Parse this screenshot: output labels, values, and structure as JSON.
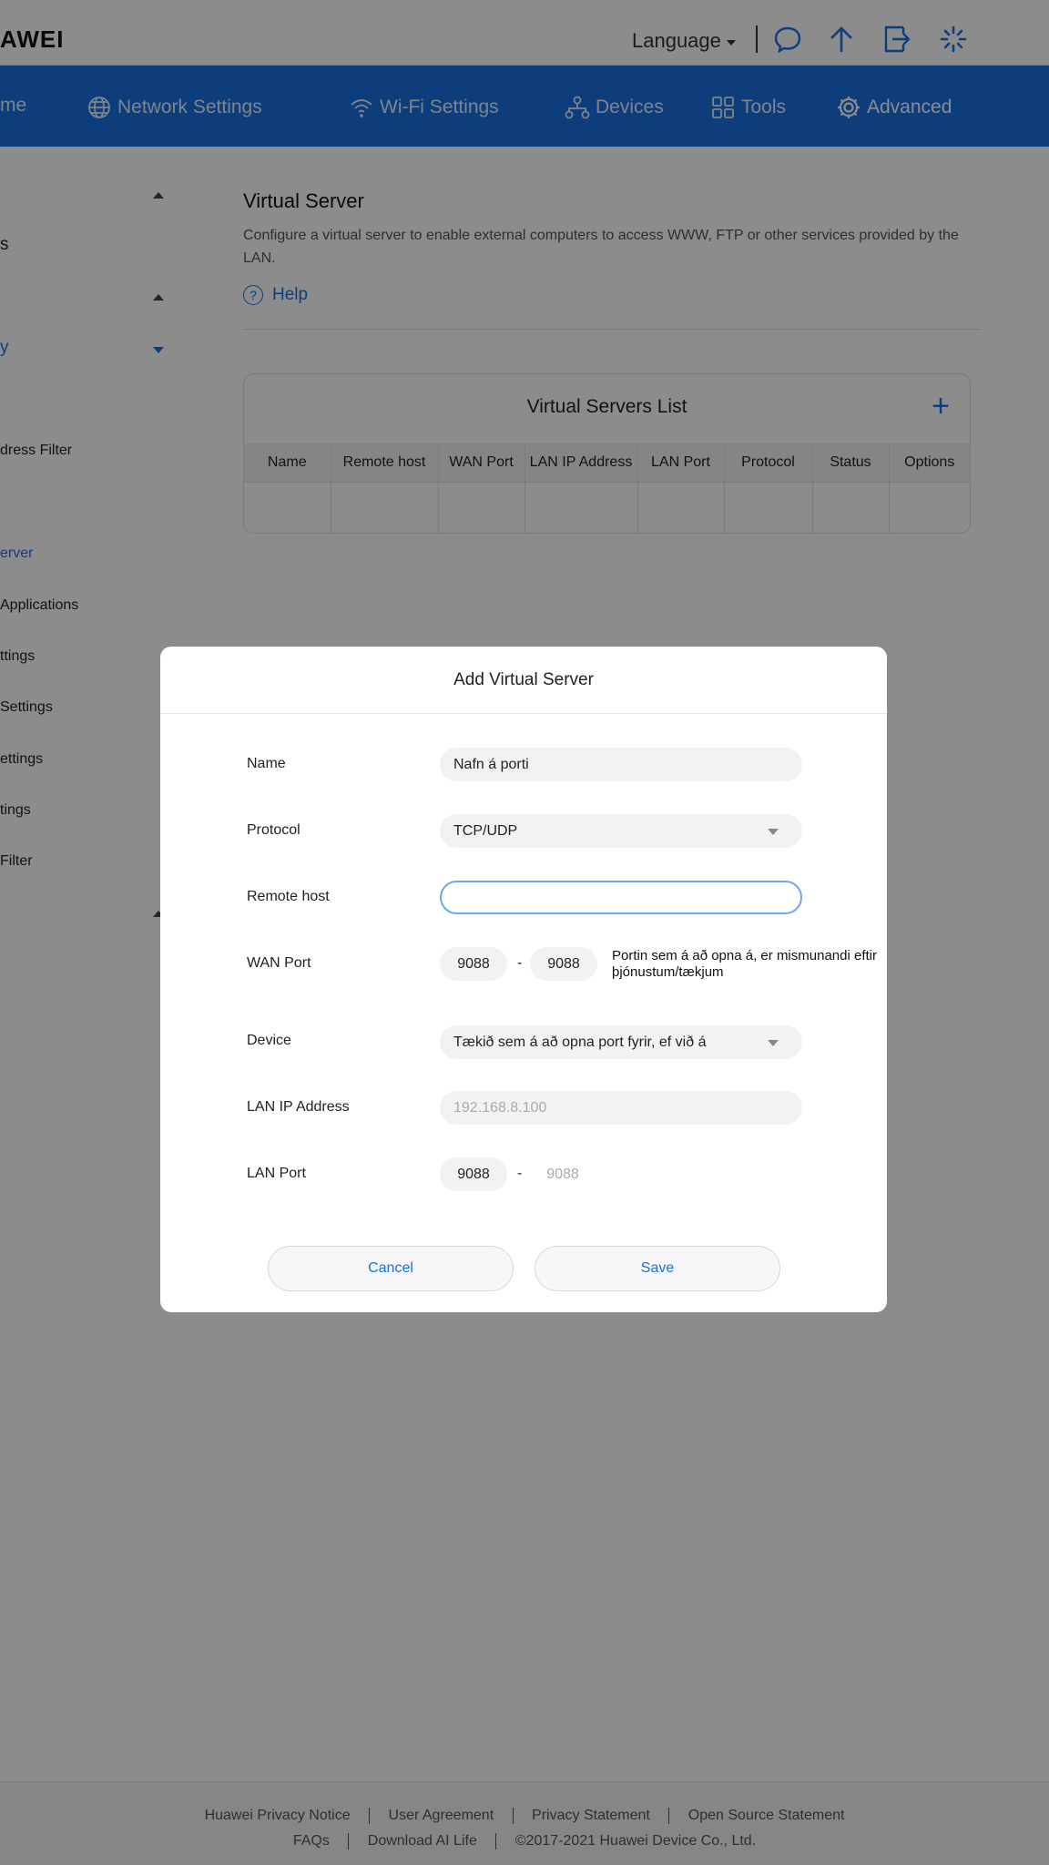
{
  "header": {
    "logo": "AWEI",
    "language_label": "Language"
  },
  "nav": {
    "items": [
      {
        "label": "me"
      },
      {
        "label": "Network Settings"
      },
      {
        "label": "Wi-Fi Settings"
      },
      {
        "label": "Devices"
      },
      {
        "label": "Tools"
      },
      {
        "label": "Advanced"
      }
    ]
  },
  "sidebar": {
    "items": [
      {
        "label": "s"
      },
      {
        "label": "y"
      },
      {
        "label": "dress Filter"
      },
      {
        "label": "erver"
      },
      {
        "label": "Applications"
      },
      {
        "label": "ttings"
      },
      {
        "label": "Settings"
      },
      {
        "label": "ettings"
      },
      {
        "label": "tings"
      },
      {
        "label": "Filter"
      }
    ]
  },
  "main": {
    "title": "Virtual Server",
    "description": "Configure a virtual server to enable external computers to access WWW, FTP or other services provided by the LAN.",
    "help_label": "Help",
    "list": {
      "title": "Virtual Servers List",
      "add_label": "+",
      "columns": [
        "Name",
        "Remote host",
        "WAN Port",
        "LAN IP Address",
        "LAN Port",
        "Protocol",
        "Status",
        "Options"
      ]
    }
  },
  "modal": {
    "title": "Add Virtual Server",
    "fields": {
      "name": {
        "label": "Name",
        "value": "Nafn á porti"
      },
      "protocol": {
        "label": "Protocol",
        "value": "TCP/UDP"
      },
      "remote_host": {
        "label": "Remote host",
        "value": ""
      },
      "wan_port": {
        "label": "WAN Port",
        "start": "9088",
        "end": "9088",
        "separator": "-",
        "hint": "Portin sem á að opna á, er mismunandi eftir þjónustum/tækjum"
      },
      "device": {
        "label": "Device",
        "value": "Tækið sem á að opna port fyrir, ef við á"
      },
      "lan_ip": {
        "label": "LAN IP Address",
        "placeholder": "192.168.8.100"
      },
      "lan_port": {
        "label": "LAN Port",
        "start": "9088",
        "end_placeholder": "9088",
        "separator": "-"
      }
    },
    "cancel_label": "Cancel",
    "save_label": "Save"
  },
  "footer": {
    "row1": [
      "Huawei Privacy Notice",
      "User Agreement",
      "Privacy Statement",
      "Open Source Statement"
    ],
    "row2": [
      "FAQs",
      "Download AI Life",
      "©2017-2021 Huawei Device Co., Ltd."
    ]
  },
  "colors": {
    "brand_blue": "#1a6fe0",
    "overlay": "rgba(0,0,0,0.45)"
  }
}
